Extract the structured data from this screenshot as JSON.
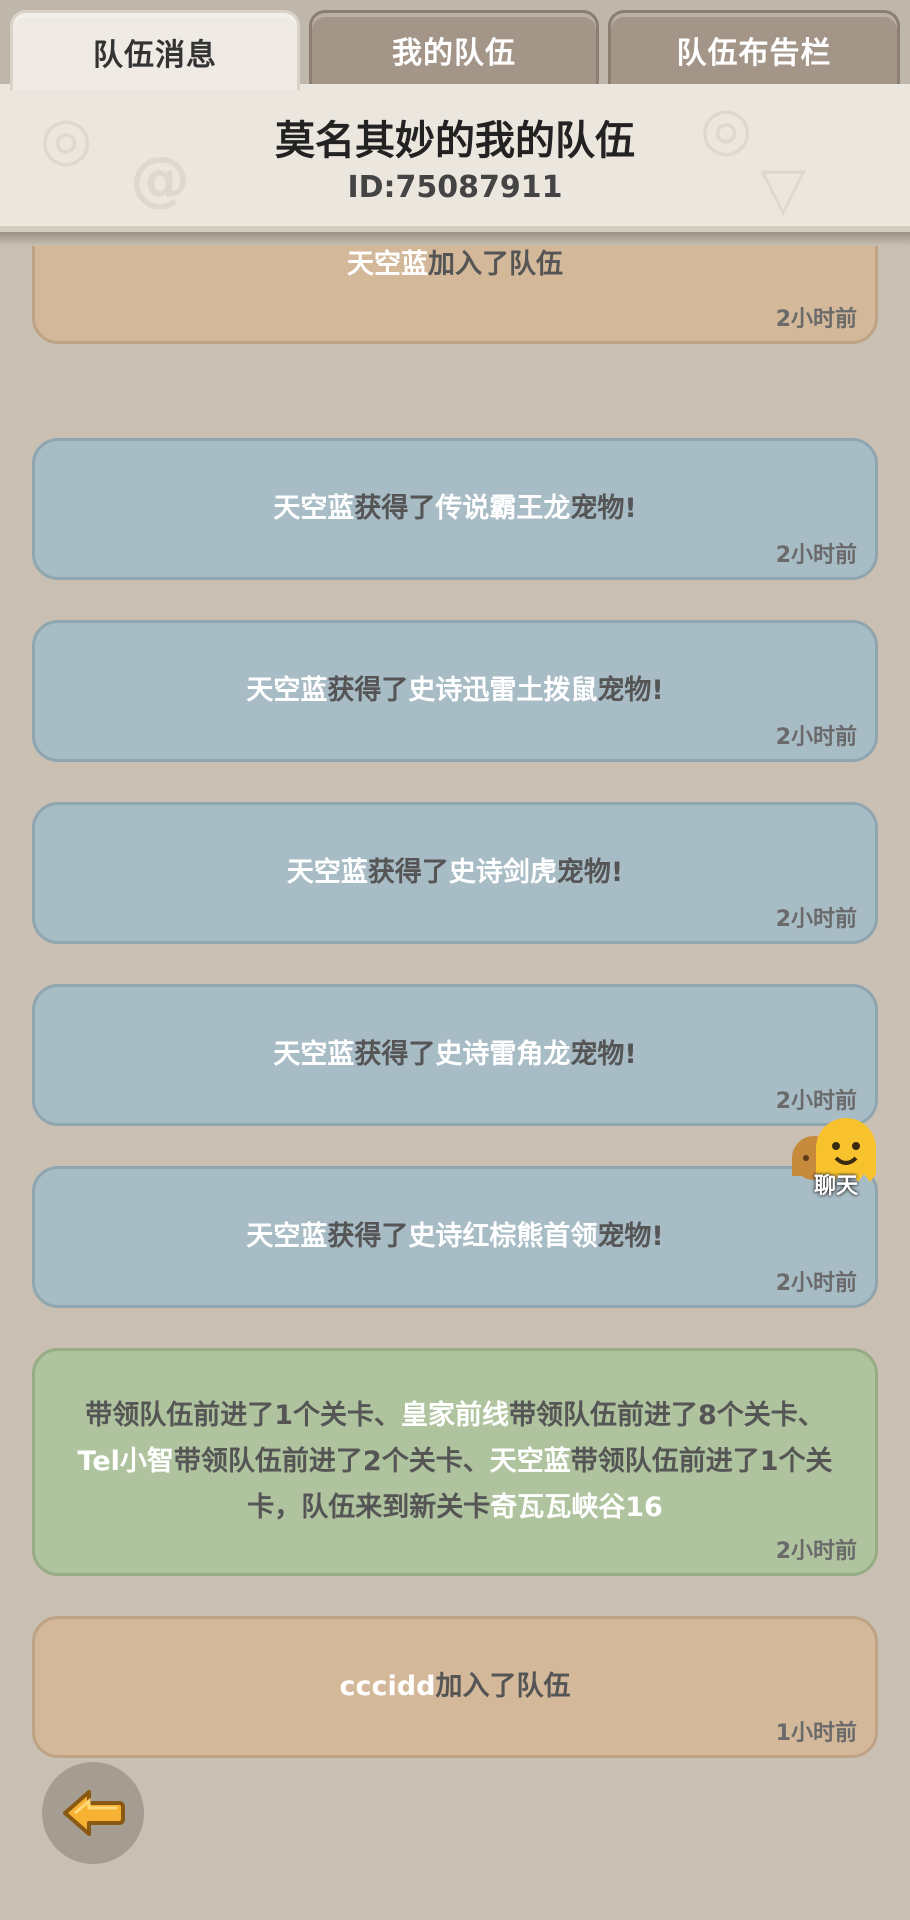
{
  "tabs": [
    {
      "label": "队伍消息",
      "active": true
    },
    {
      "label": "我的队伍",
      "active": false
    },
    {
      "label": "队伍布告栏",
      "active": false
    }
  ],
  "header": {
    "team_name": "莫名其妙的我的队伍",
    "team_id": "ID:75087911"
  },
  "messages": [
    {
      "type": "tan",
      "parts": [
        {
          "t": "天空蓝",
          "c": "light"
        },
        {
          "t": "加入了队伍",
          "c": "dark"
        }
      ],
      "time": "2小时前"
    },
    {
      "type": "blue",
      "parts": [
        {
          "t": "天空蓝",
          "c": "light"
        },
        {
          "t": "获得了",
          "c": "dark"
        },
        {
          "t": "传说霸王龙",
          "c": "light"
        },
        {
          "t": "宠物!",
          "c": "dark"
        }
      ],
      "time": "2小时前"
    },
    {
      "type": "blue",
      "parts": [
        {
          "t": "天空蓝",
          "c": "light"
        },
        {
          "t": "获得了",
          "c": "dark"
        },
        {
          "t": "史诗迅雷土拨鼠",
          "c": "light"
        },
        {
          "t": "宠物!",
          "c": "dark"
        }
      ],
      "time": "2小时前"
    },
    {
      "type": "blue",
      "parts": [
        {
          "t": "天空蓝",
          "c": "light"
        },
        {
          "t": "获得了",
          "c": "dark"
        },
        {
          "t": "史诗剑虎",
          "c": "light"
        },
        {
          "t": "宠物!",
          "c": "dark"
        }
      ],
      "time": "2小时前"
    },
    {
      "type": "blue",
      "parts": [
        {
          "t": "天空蓝",
          "c": "light"
        },
        {
          "t": "获得了",
          "c": "dark"
        },
        {
          "t": "史诗雷角龙",
          "c": "light"
        },
        {
          "t": "宠物!",
          "c": "dark"
        }
      ],
      "time": "2小时前"
    },
    {
      "type": "blue",
      "parts": [
        {
          "t": "天空蓝",
          "c": "light"
        },
        {
          "t": "获得了",
          "c": "dark"
        },
        {
          "t": "史诗红棕熊首领",
          "c": "light"
        },
        {
          "t": "宠物!",
          "c": "dark"
        }
      ],
      "time": "2小时前"
    },
    {
      "type": "green",
      "parts": [
        {
          "t": "带领队伍前进了1个关卡、",
          "c": "dark"
        },
        {
          "t": "皇家前线",
          "c": "light"
        },
        {
          "t": "带领队伍前进了8个关卡、",
          "c": "dark"
        },
        {
          "t": "Tel小智",
          "c": "light"
        },
        {
          "t": "带领队伍前进了2个关卡、",
          "c": "dark"
        },
        {
          "t": "天空蓝",
          "c": "light"
        },
        {
          "t": "带领队伍前进了1个关卡，队伍来到新关卡",
          "c": "dark"
        },
        {
          "t": "奇瓦瓦峡谷16",
          "c": "light"
        }
      ],
      "time": "2小时前"
    },
    {
      "type": "tan",
      "parts": [
        {
          "t": "cccidd",
          "c": "light"
        },
        {
          "t": "加入了队伍",
          "c": "dark"
        }
      ],
      "time": "1小时前"
    }
  ],
  "chat": {
    "label": "聊天",
    "icon": "chat-bubble-icon"
  },
  "back": {
    "icon": "back-arrow-icon"
  },
  "colors": {
    "blue_card": "#a8bcc6",
    "tan_card": "#d3b89a",
    "green_card": "#afc49e",
    "background": "#c9bfb3"
  }
}
